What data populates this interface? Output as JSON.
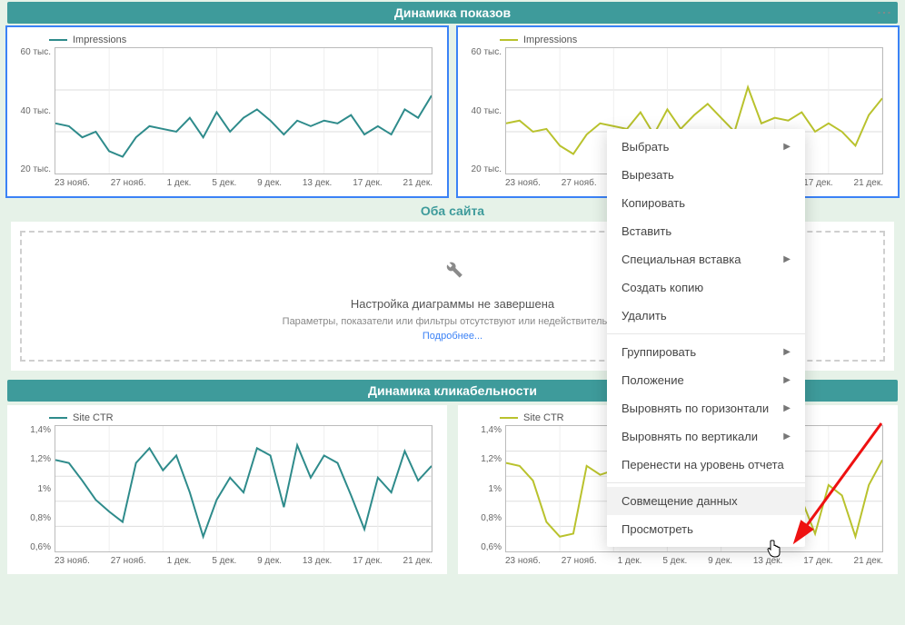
{
  "headers": {
    "impressions": "Динамика показов",
    "both_sites": "Оба сайта",
    "ctr": "Динамика кликабельности"
  },
  "config_card": {
    "title": "Настройка диаграммы не завершена",
    "subtitle": "Параметры, показатели или фильтры отсутствуют или недействительны.",
    "link": "Подробнее..."
  },
  "context_menu": {
    "select": "Выбрать",
    "cut": "Вырезать",
    "copy": "Копировать",
    "paste": "Вставить",
    "paste_special": "Специальная вставка",
    "duplicate": "Создать копию",
    "delete": "Удалить",
    "group": "Группировать",
    "position": "Положение",
    "align_h": "Выровнять по горизонтали",
    "align_v": "Выровнять по вертикали",
    "to_report_level": "Перенести на уровень отчета",
    "data_blending": "Совмещение данных",
    "view": "Просмотреть"
  },
  "chart_data": [
    {
      "id": "impressions_left",
      "type": "line",
      "title": "",
      "legend": "Impressions",
      "color": "#2e8b8b",
      "x_categories": [
        "23 нояб.",
        "27 нояб.",
        "1 дек.",
        "5 дек.",
        "9 дек.",
        "13 дек.",
        "17 дек.",
        "21 дек."
      ],
      "y_ticks": [
        "60 тыс.",
        "40 тыс.",
        "20 тыс."
      ],
      "ylim": [
        15,
        60
      ],
      "series": [
        {
          "name": "Impressions",
          "values": [
            33,
            32,
            28,
            30,
            23,
            21,
            28,
            32,
            31,
            30,
            35,
            28,
            37,
            30,
            35,
            38,
            34,
            29,
            34,
            32,
            34,
            33,
            36,
            29,
            32,
            29,
            38,
            35,
            43
          ]
        }
      ]
    },
    {
      "id": "impressions_right",
      "type": "line",
      "title": "",
      "legend": "Impressions",
      "color": "#b9c22d",
      "x_categories": [
        "23 нояб.",
        "27 нояб.",
        "1 дек.",
        "5 дек.",
        "9 дек.",
        "13 дек.",
        "17 дек.",
        "21 дек."
      ],
      "y_ticks": [
        "60 тыс.",
        "40 тыс.",
        "20 тыс."
      ],
      "ylim": [
        15,
        60
      ],
      "series": [
        {
          "name": "Impressions",
          "values": [
            33,
            34,
            30,
            31,
            25,
            22,
            29,
            33,
            32,
            31,
            37,
            29,
            38,
            31,
            36,
            40,
            35,
            30,
            46,
            33,
            35,
            34,
            37,
            30,
            33,
            30,
            25,
            36,
            42
          ]
        }
      ]
    },
    {
      "id": "ctr_left",
      "type": "line",
      "title": "",
      "legend": "Site CTR",
      "color": "#2e8b8b",
      "x_categories": [
        "23 нояб.",
        "27 нояб.",
        "1 дек.",
        "5 дек.",
        "9 дек.",
        "13 дек.",
        "17 дек.",
        "21 дек."
      ],
      "y_ticks": [
        "1,4%",
        "1,2%",
        "1%",
        "0,8%",
        "0,6%"
      ],
      "ylim": [
        0.6,
        1.45
      ],
      "series": [
        {
          "name": "Site CTR",
          "values": [
            1.22,
            1.2,
            1.08,
            0.95,
            0.87,
            0.8,
            1.2,
            1.3,
            1.15,
            1.25,
            1.0,
            0.7,
            0.95,
            1.1,
            1.0,
            1.3,
            1.25,
            0.9,
            1.32,
            1.1,
            1.25,
            1.2,
            0.98,
            0.75,
            1.1,
            1.0,
            1.28,
            1.08,
            1.18
          ]
        }
      ]
    },
    {
      "id": "ctr_right",
      "type": "line",
      "title": "",
      "legend": "Site CTR",
      "color": "#b9c22d",
      "x_categories": [
        "23 нояб.",
        "27 нояб.",
        "1 дек.",
        "5 дек.",
        "9 дек.",
        "13 дек.",
        "17 дек.",
        "21 дек."
      ],
      "y_ticks": [
        "1,4%",
        "1,2%",
        "1%",
        "0,8%",
        "0,6%"
      ],
      "ylim": [
        0.6,
        1.45
      ],
      "series": [
        {
          "name": "Site CTR",
          "values": [
            1.2,
            1.18,
            1.08,
            0.8,
            0.7,
            0.72,
            1.18,
            1.12,
            1.15,
            1.1,
            1.0,
            0.78,
            0.95,
            1.0,
            1.0,
            1.2,
            1.22,
            0.92,
            1.3,
            1.05,
            1.15,
            1.18,
            0.95,
            0.72,
            1.05,
            0.98,
            0.7,
            1.05,
            1.22
          ]
        }
      ]
    }
  ]
}
